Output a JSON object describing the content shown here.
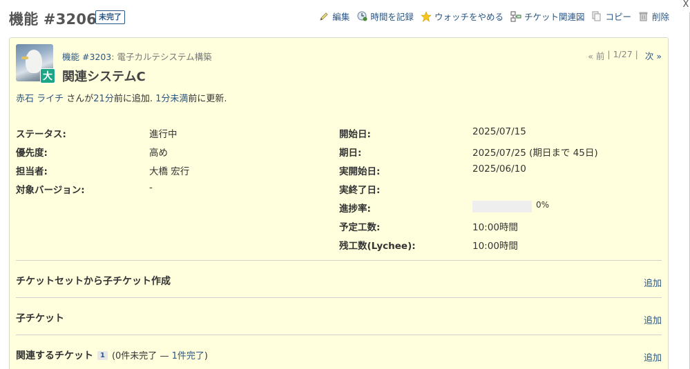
{
  "header": {
    "title": "機能 #3206",
    "status": "未完了",
    "actions": [
      {
        "label": "編集",
        "icon": "pencil-icon"
      },
      {
        "label": "時間を記録",
        "icon": "clock-icon"
      },
      {
        "label": "ウォッチをやめる",
        "icon": "star-icon"
      },
      {
        "label": "チケット関連図",
        "icon": "diagram-icon"
      },
      {
        "label": "コピー",
        "icon": "copy-icon"
      },
      {
        "label": "削除",
        "icon": "trash-icon"
      }
    ],
    "close": "X"
  },
  "issue": {
    "avatar": {
      "priority_tag": "大"
    },
    "parent": {
      "link": "機能 #3203",
      "suffix": ": 電子カルテシステム構築"
    },
    "subject": "関連システムC",
    "pager": {
      "prev": "« 前",
      "sep1": "|",
      "position": "1/27",
      "sep2": "|",
      "next": "次 »"
    },
    "author": {
      "name": "赤石 ライチ",
      "text1": " さんが",
      "added_ago": "21分",
      "text2": "前に追加. ",
      "updated_ago": "1分未満",
      "text3": "前に更新."
    },
    "left_attrs": [
      {
        "label": "ステータス:",
        "value": "進行中"
      },
      {
        "label": "優先度:",
        "value": "高め"
      },
      {
        "label": "担当者:",
        "value": "大橋 宏行"
      },
      {
        "label": "対象バージョン:",
        "value": "-"
      }
    ],
    "right_attrs": [
      {
        "label": "開始日:",
        "value": "2025/07/15"
      },
      {
        "label": "期日:",
        "value": "2025/07/25 (期日まで 45日)"
      },
      {
        "label": "実開始日:",
        "value": "2025/06/10"
      },
      {
        "label": "実終了日:",
        "value": ""
      },
      {
        "label": "進捗率:",
        "value": ""
      },
      {
        "label": "予定工数:",
        "value": "10:00時間"
      },
      {
        "label": "残工数(Lychee):",
        "value": "10:00時間"
      }
    ],
    "progress": {
      "percent": 0,
      "text": "0%"
    },
    "sections": [
      {
        "title": "チケットセットから子チケット作成",
        "add": "追加"
      },
      {
        "title": "子チケット",
        "add": "追加"
      },
      {
        "title": "関連するチケット",
        "count": "1",
        "extra_open": "(0件未完了 — ",
        "extra_link": "1件完了",
        "extra_close": ")",
        "add": "追加"
      }
    ]
  },
  "colors": {
    "link": "#2a5685",
    "issue_bg": "#ffffdd",
    "priority_tag": "#1ba686"
  }
}
